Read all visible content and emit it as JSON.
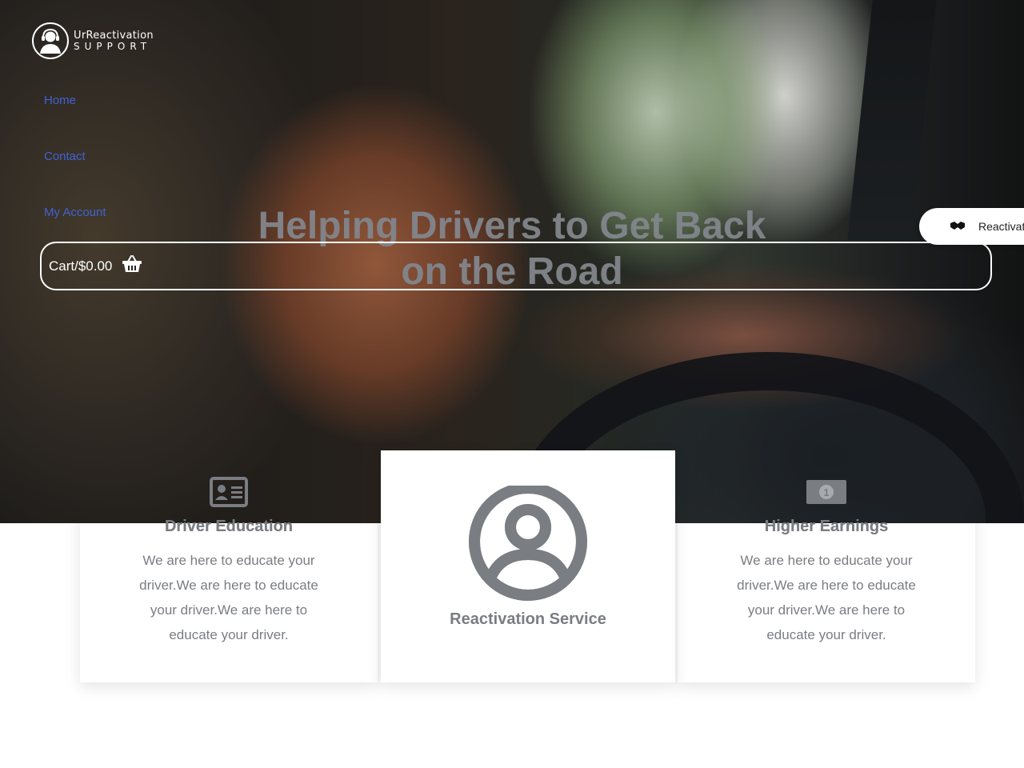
{
  "header": {
    "logo": {
      "brand": "UrReactivation",
      "sub": "SUPPORT",
      "icon": "headset-user-icon"
    }
  },
  "nav": {
    "items": [
      {
        "label": "Home"
      },
      {
        "label": "Contact"
      },
      {
        "label": "My Account"
      }
    ]
  },
  "cart": {
    "label": "Cart/$0.00",
    "icon": "shopping-basket-icon"
  },
  "hero": {
    "title_line1": "Helping Drivers to Get Back",
    "title_line2": "on the Road"
  },
  "float_tab": {
    "label": "Reactivat",
    "icon": "handshake-icon"
  },
  "features": [
    {
      "title": "Driver Education",
      "text": "We are here to educate your driver.We are here to educate your driver.We are here to educate your driver.",
      "icon": "id-card-icon"
    },
    {
      "title": "Reactivation Service",
      "icon": "user-circle-icon"
    },
    {
      "title": "Higher Earnings",
      "text": "We are here to educate your driver.We are here to educate your driver.We are here to educate your driver.",
      "icon": "money-bill-icon"
    }
  ],
  "colors": {
    "nav_link": "#4162d2",
    "card_text": "#7a7d82",
    "hero_title": "#82868c"
  }
}
